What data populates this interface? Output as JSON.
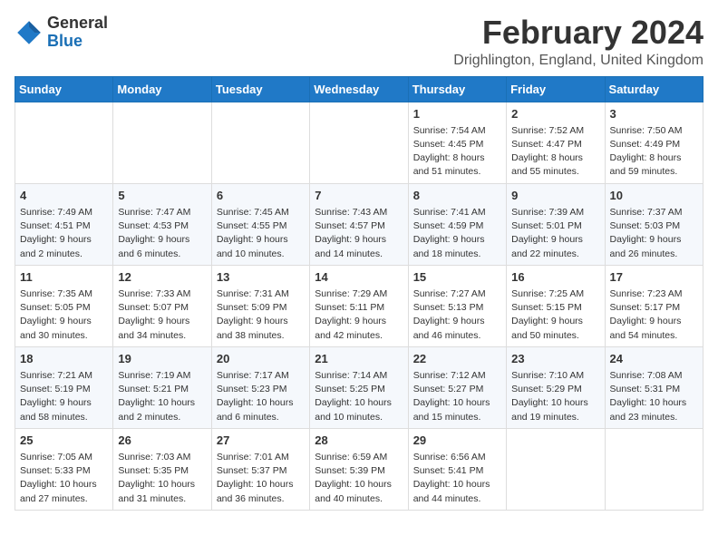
{
  "header": {
    "logo_line1": "General",
    "logo_line2": "Blue",
    "month_title": "February 2024",
    "location": "Drighlington, England, United Kingdom"
  },
  "calendar": {
    "days_of_week": [
      "Sunday",
      "Monday",
      "Tuesday",
      "Wednesday",
      "Thursday",
      "Friday",
      "Saturday"
    ],
    "weeks": [
      [
        {
          "day": "",
          "info": ""
        },
        {
          "day": "",
          "info": ""
        },
        {
          "day": "",
          "info": ""
        },
        {
          "day": "",
          "info": ""
        },
        {
          "day": "1",
          "info": "Sunrise: 7:54 AM\nSunset: 4:45 PM\nDaylight: 8 hours and 51 minutes."
        },
        {
          "day": "2",
          "info": "Sunrise: 7:52 AM\nSunset: 4:47 PM\nDaylight: 8 hours and 55 minutes."
        },
        {
          "day": "3",
          "info": "Sunrise: 7:50 AM\nSunset: 4:49 PM\nDaylight: 8 hours and 59 minutes."
        }
      ],
      [
        {
          "day": "4",
          "info": "Sunrise: 7:49 AM\nSunset: 4:51 PM\nDaylight: 9 hours and 2 minutes."
        },
        {
          "day": "5",
          "info": "Sunrise: 7:47 AM\nSunset: 4:53 PM\nDaylight: 9 hours and 6 minutes."
        },
        {
          "day": "6",
          "info": "Sunrise: 7:45 AM\nSunset: 4:55 PM\nDaylight: 9 hours and 10 minutes."
        },
        {
          "day": "7",
          "info": "Sunrise: 7:43 AM\nSunset: 4:57 PM\nDaylight: 9 hours and 14 minutes."
        },
        {
          "day": "8",
          "info": "Sunrise: 7:41 AM\nSunset: 4:59 PM\nDaylight: 9 hours and 18 minutes."
        },
        {
          "day": "9",
          "info": "Sunrise: 7:39 AM\nSunset: 5:01 PM\nDaylight: 9 hours and 22 minutes."
        },
        {
          "day": "10",
          "info": "Sunrise: 7:37 AM\nSunset: 5:03 PM\nDaylight: 9 hours and 26 minutes."
        }
      ],
      [
        {
          "day": "11",
          "info": "Sunrise: 7:35 AM\nSunset: 5:05 PM\nDaylight: 9 hours and 30 minutes."
        },
        {
          "day": "12",
          "info": "Sunrise: 7:33 AM\nSunset: 5:07 PM\nDaylight: 9 hours and 34 minutes."
        },
        {
          "day": "13",
          "info": "Sunrise: 7:31 AM\nSunset: 5:09 PM\nDaylight: 9 hours and 38 minutes."
        },
        {
          "day": "14",
          "info": "Sunrise: 7:29 AM\nSunset: 5:11 PM\nDaylight: 9 hours and 42 minutes."
        },
        {
          "day": "15",
          "info": "Sunrise: 7:27 AM\nSunset: 5:13 PM\nDaylight: 9 hours and 46 minutes."
        },
        {
          "day": "16",
          "info": "Sunrise: 7:25 AM\nSunset: 5:15 PM\nDaylight: 9 hours and 50 minutes."
        },
        {
          "day": "17",
          "info": "Sunrise: 7:23 AM\nSunset: 5:17 PM\nDaylight: 9 hours and 54 minutes."
        }
      ],
      [
        {
          "day": "18",
          "info": "Sunrise: 7:21 AM\nSunset: 5:19 PM\nDaylight: 9 hours and 58 minutes."
        },
        {
          "day": "19",
          "info": "Sunrise: 7:19 AM\nSunset: 5:21 PM\nDaylight: 10 hours and 2 minutes."
        },
        {
          "day": "20",
          "info": "Sunrise: 7:17 AM\nSunset: 5:23 PM\nDaylight: 10 hours and 6 minutes."
        },
        {
          "day": "21",
          "info": "Sunrise: 7:14 AM\nSunset: 5:25 PM\nDaylight: 10 hours and 10 minutes."
        },
        {
          "day": "22",
          "info": "Sunrise: 7:12 AM\nSunset: 5:27 PM\nDaylight: 10 hours and 15 minutes."
        },
        {
          "day": "23",
          "info": "Sunrise: 7:10 AM\nSunset: 5:29 PM\nDaylight: 10 hours and 19 minutes."
        },
        {
          "day": "24",
          "info": "Sunrise: 7:08 AM\nSunset: 5:31 PM\nDaylight: 10 hours and 23 minutes."
        }
      ],
      [
        {
          "day": "25",
          "info": "Sunrise: 7:05 AM\nSunset: 5:33 PM\nDaylight: 10 hours and 27 minutes."
        },
        {
          "day": "26",
          "info": "Sunrise: 7:03 AM\nSunset: 5:35 PM\nDaylight: 10 hours and 31 minutes."
        },
        {
          "day": "27",
          "info": "Sunrise: 7:01 AM\nSunset: 5:37 PM\nDaylight: 10 hours and 36 minutes."
        },
        {
          "day": "28",
          "info": "Sunrise: 6:59 AM\nSunset: 5:39 PM\nDaylight: 10 hours and 40 minutes."
        },
        {
          "day": "29",
          "info": "Sunrise: 6:56 AM\nSunset: 5:41 PM\nDaylight: 10 hours and 44 minutes."
        },
        {
          "day": "",
          "info": ""
        },
        {
          "day": "",
          "info": ""
        }
      ]
    ]
  }
}
